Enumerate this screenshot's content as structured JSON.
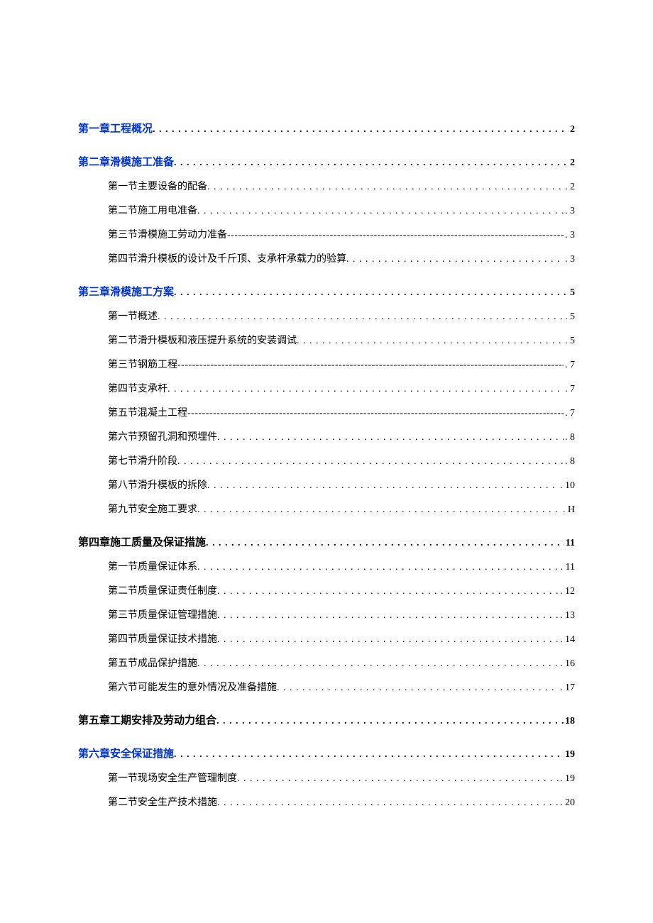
{
  "toc": [
    {
      "level": 1,
      "label": "第一章工程概况",
      "page": "2",
      "color": "blue",
      "leader": "dot",
      "gapAfter": true
    },
    {
      "level": 1,
      "label": "第二章滑模施工准备",
      "page": "2",
      "color": "blue",
      "leader": "dot"
    },
    {
      "level": 2,
      "label": "第一节主要设备的配备",
      "page": "2",
      "leader": "dot"
    },
    {
      "level": 2,
      "label": "第二节施工用电准备",
      "page": "3",
      "leader": "dot"
    },
    {
      "level": 2,
      "label": "第三节滑模施工劳动力准备",
      "page": "3",
      "leader": "dash"
    },
    {
      "level": 2,
      "label": "第四节滑升模板的设计及千斤顶、支承杆承载力的验算",
      "page": "3",
      "leader": "dot",
      "gapAfter": true
    },
    {
      "level": 1,
      "label": "第三章滑模施工方案",
      "page": "5",
      "color": "blue",
      "leader": "dot"
    },
    {
      "level": 2,
      "label": "第一节概述",
      "page": "5",
      "leader": "dot"
    },
    {
      "level": 2,
      "label": "第二节滑升模板和液压提升系统的安装调试",
      "page": "5",
      "leader": "dot"
    },
    {
      "level": 2,
      "label": "第三节钢筋工程",
      "page": "7",
      "leader": "dash"
    },
    {
      "level": 2,
      "label": "第四节支承杆",
      "page": "7",
      "leader": "dot"
    },
    {
      "level": 2,
      "label": "第五节混凝土工程",
      "page": "7",
      "leader": "dash"
    },
    {
      "level": 2,
      "label": "第六节预留孔洞和预埋件",
      "page": "8",
      "leader": "dot"
    },
    {
      "level": 2,
      "label": "第七节滑升阶段",
      "page": "8",
      "leader": "dot"
    },
    {
      "level": 2,
      "label": "第八节滑升模板的拆除",
      "page": "10",
      "leader": "dot"
    },
    {
      "level": 2,
      "label": "第九节安全施工要求",
      "page": "H",
      "leader": "dot",
      "spaceBefore": true,
      "gapAfter": true
    },
    {
      "level": 1,
      "label": "第四章施工质量及保证措施",
      "page": "11",
      "color": "black",
      "leader": "dot"
    },
    {
      "level": 2,
      "label": "第一节质量保证体系",
      "page": "11",
      "leader": "dot"
    },
    {
      "level": 2,
      "label": "第二节质量保证责任制度",
      "page": "12",
      "leader": "dot"
    },
    {
      "level": 2,
      "label": "第三节质量保证管理措施",
      "page": "13",
      "leader": "dot"
    },
    {
      "level": 2,
      "label": "第四节质量保证技术措施",
      "page": "14",
      "leader": "dot"
    },
    {
      "level": 2,
      "label": "第五节成品保护措施",
      "page": "16",
      "leader": "dot"
    },
    {
      "level": 2,
      "label": "第六节可能发生的意外情况及准备措施",
      "page": "17",
      "leader": "dot",
      "gapAfter": true
    },
    {
      "level": 1,
      "label": "第五章工期安排及劳动力组合",
      "page": "18",
      "color": "black",
      "leader": "dot",
      "gapAfter": true
    },
    {
      "level": 1,
      "label": "第六章安全保证措施",
      "page": "19",
      "color": "blue",
      "leader": "dot"
    },
    {
      "level": 2,
      "label": "第一节现场安全生产管理制度",
      "page": "19",
      "leader": "dot"
    },
    {
      "level": 2,
      "label": "第二节安全生产技术措施",
      "page": "20",
      "leader": "dot"
    }
  ]
}
